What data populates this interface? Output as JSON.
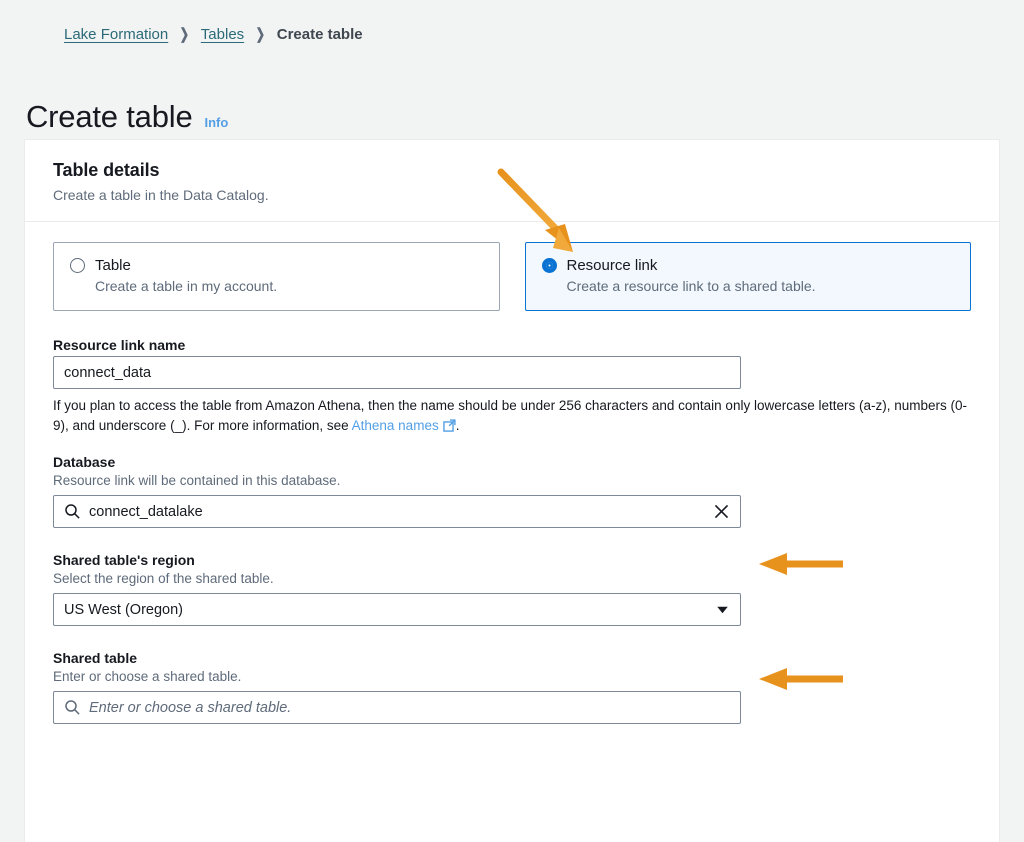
{
  "breadcrumb": {
    "items": [
      {
        "label": "Lake Formation",
        "type": "link"
      },
      {
        "label": "Tables",
        "type": "link"
      },
      {
        "label": "Create table",
        "type": "current"
      }
    ],
    "separator": "❯"
  },
  "header": {
    "title": "Create table",
    "info_label": "Info"
  },
  "card": {
    "title": "Table details",
    "subtitle": "Create a table in the Data Catalog."
  },
  "tiles": [
    {
      "label": "Table",
      "description": "Create a table in my account.",
      "selected": false
    },
    {
      "label": "Resource link",
      "description": "Create a resource link to a shared table.",
      "selected": true
    }
  ],
  "fields": {
    "resource_link_name": {
      "label": "Resource link name",
      "value": "connect_data",
      "helper_part1": "If you plan to access the table from Amazon Athena, then the name should be under 256 characters and contain only lowercase letters (a-z), numbers (0-9), and underscore (_). For more information, see ",
      "helper_link": "Athena names",
      "helper_part2": "."
    },
    "database": {
      "label": "Database",
      "sublabel": "Resource link will be contained in this database.",
      "value": "connect_datalake",
      "search_icon": "search-icon",
      "clear_icon": "close-icon"
    },
    "shared_table_region": {
      "label": "Shared table's region",
      "sublabel": "Select the region of the shared table.",
      "value": "US West (Oregon)",
      "chevron_icon": "chevron-down-icon"
    },
    "shared_table": {
      "label": "Shared table",
      "sublabel": "Enter or choose a shared table.",
      "value": "",
      "placeholder": "Enter or choose a shared table.",
      "search_icon": "search-icon"
    }
  },
  "annotations": {
    "arrow_color": "#e8921e",
    "arrows": [
      {
        "name": "arrow-to-resource-link-tile",
        "direction": "down-right"
      },
      {
        "name": "arrow-to-database-field",
        "direction": "left"
      },
      {
        "name": "arrow-to-region-field",
        "direction": "left"
      }
    ]
  },
  "colors": {
    "page_background": "#f2f3f3",
    "accent_blue": "#0972d3",
    "link_blue": "#539fe5",
    "breadcrumb_link": "#2b6a78",
    "selected_tile_background": "#f2f8fd",
    "orange": "#e8921e"
  }
}
